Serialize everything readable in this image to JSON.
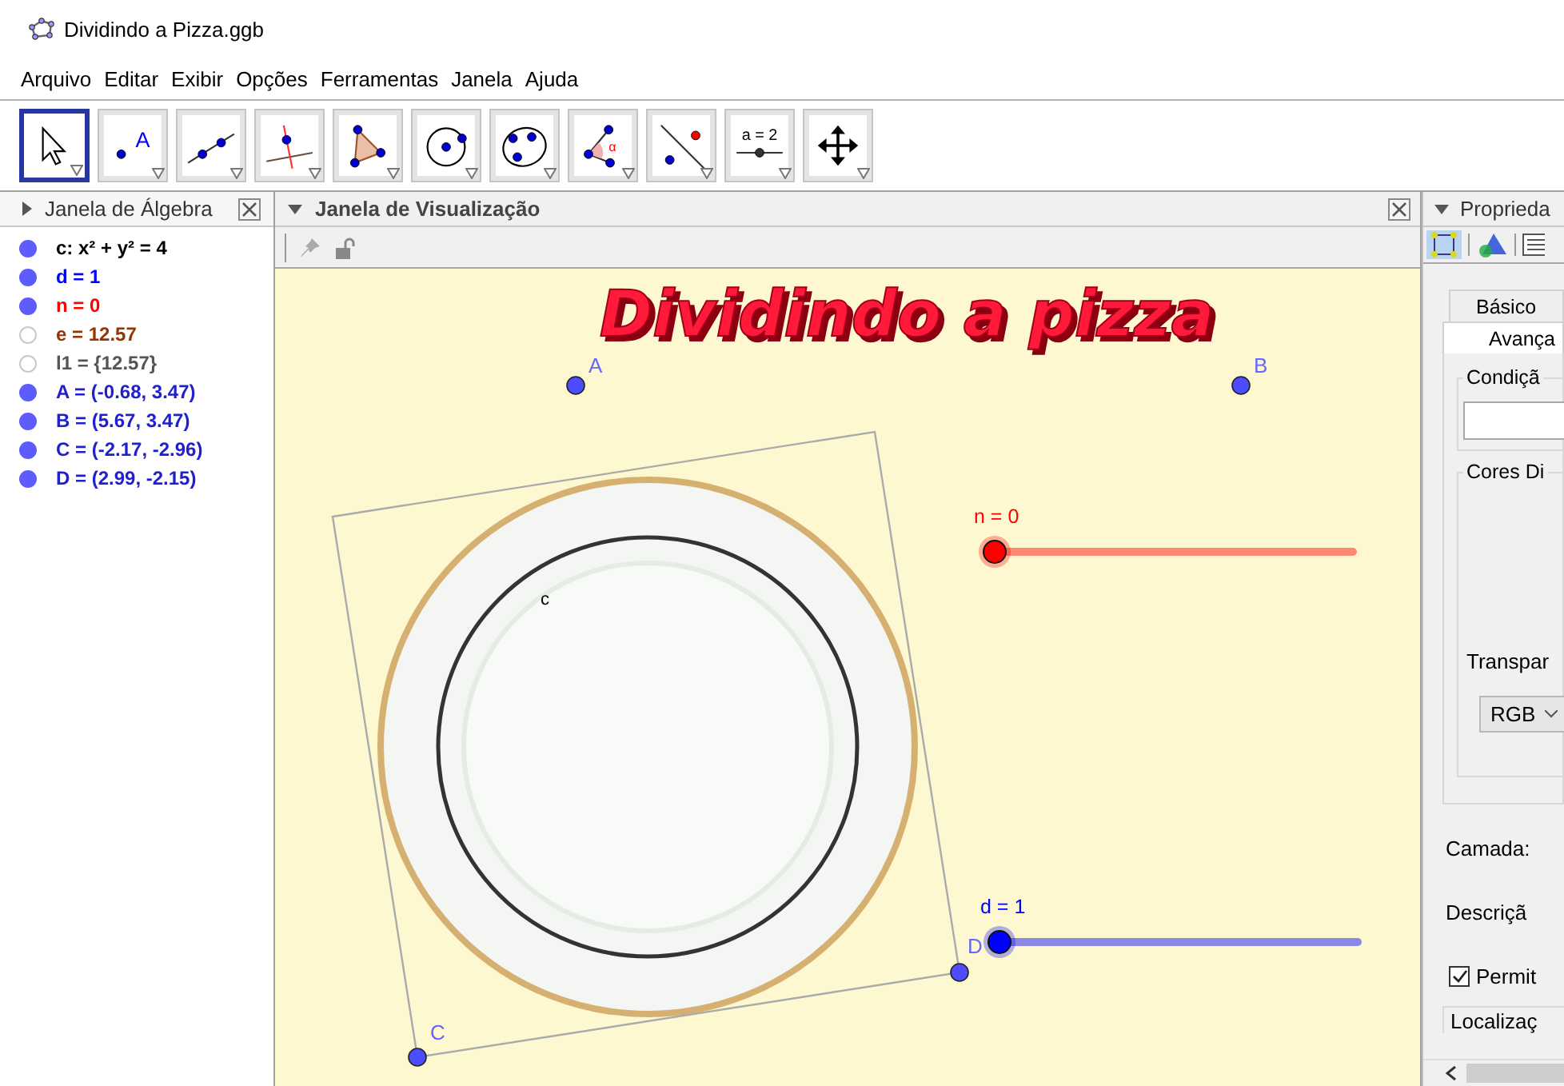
{
  "window": {
    "title": "Dividindo a Pizza.ggb"
  },
  "menu": [
    "Arquivo",
    "Editar",
    "Exibir",
    "Opções",
    "Ferramentas",
    "Janela",
    "Ajuda"
  ],
  "tools": [
    {
      "kind": "move",
      "selected": true
    },
    {
      "kind": "point",
      "selected": false,
      "label": "A"
    },
    {
      "kind": "line",
      "selected": false
    },
    {
      "kind": "perpendicular",
      "selected": false
    },
    {
      "kind": "polygon",
      "selected": false
    },
    {
      "kind": "circle",
      "selected": false
    },
    {
      "kind": "conic",
      "selected": false
    },
    {
      "kind": "angle",
      "selected": false,
      "label": "α"
    },
    {
      "kind": "reflect",
      "selected": false
    },
    {
      "kind": "slider",
      "selected": false,
      "label": "a = 2"
    },
    {
      "kind": "move-view",
      "selected": false
    }
  ],
  "algebra": {
    "title": "Janela de Álgebra",
    "items": [
      {
        "text": "c: x² + y² = 4",
        "color": "#000000",
        "visible": true
      },
      {
        "text": "d = 1",
        "color": "#0000ff",
        "visible": true
      },
      {
        "text": "n = 0",
        "color": "#ff0000",
        "visible": true
      },
      {
        "text": "e = 12.57",
        "color": "#993300",
        "visible": false
      },
      {
        "text": "l1 = {12.57}",
        "color": "#555555",
        "visible": false
      },
      {
        "text": "A = (-0.68, 3.47)",
        "color": "#2020cc",
        "visible": true
      },
      {
        "text": "B = (5.67, 3.47)",
        "color": "#2020cc",
        "visible": true
      },
      {
        "text": "C = (-2.17, -2.96)",
        "color": "#2020cc",
        "visible": true
      },
      {
        "text": "D = (2.99, -2.15)",
        "color": "#2020cc",
        "visible": true
      }
    ]
  },
  "graphics": {
    "title": "Janela de Visualização",
    "heading": "Dividindo a pizza",
    "curve_label": "c",
    "points": [
      {
        "label": "A"
      },
      {
        "label": "B"
      },
      {
        "label": "C"
      },
      {
        "label": "D"
      }
    ],
    "sliders": [
      {
        "label": "n = 0",
        "level": 0,
        "color": "#ff0000"
      },
      {
        "label": "d = 1",
        "level": 0,
        "color": "#0000ff"
      }
    ]
  },
  "properties": {
    "title": "Proprieda",
    "tabs": [
      {
        "label": "Básico",
        "selected": false
      },
      {
        "label": "Avança",
        "selected": true
      }
    ],
    "condition_label": "Condiçã",
    "dynamic_colors_label": "Cores Di",
    "transparency_label": "Transpar",
    "color_model": "RGB",
    "layer_label": "Camada:",
    "description_label": "Descriçã",
    "checkbox": {
      "label": "Permit",
      "checked": true
    },
    "location_label": "Localizaç"
  }
}
